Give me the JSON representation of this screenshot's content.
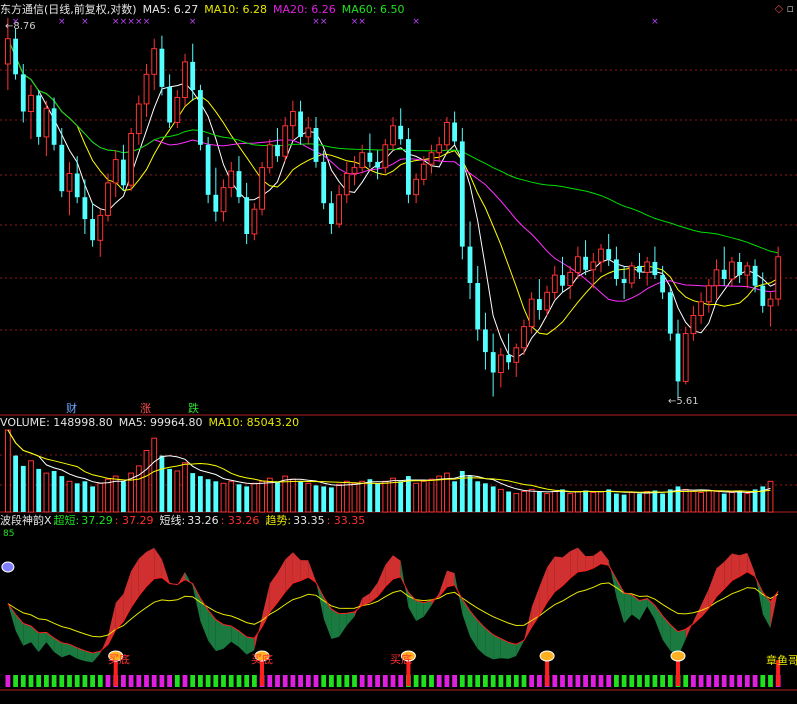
{
  "main_header": {
    "title": "东方通信(日线,前复权,对数)",
    "ma5_label": "MA5: 6.27",
    "ma10_label": "MA10: 6.28",
    "ma20_label": "MA20: 6.26",
    "ma60_label": "MA60: 6.50"
  },
  "corner": {
    "diamond": "◇",
    "square": "▫"
  },
  "price_marks": {
    "high": "8.76",
    "low": "5.61"
  },
  "event_labels": {
    "cai": "财",
    "zhang": "涨",
    "die": "跌"
  },
  "volume_header": {
    "label": "VOLUME: 148998.80",
    "ma5": "MA5: 99964.80",
    "ma10": "MA10: 85043.20"
  },
  "indicator_header": {
    "name": "波段神韵X",
    "chaoduan_label": "超短:",
    "chaoduan_val1": "37.29",
    "chaoduan_val2": ": 37.29",
    "duanxian_label": "短线:",
    "duanxian_val1": "33.26",
    "duanxian_val2": ": 33.26",
    "qushi_label": "趋势:",
    "qushi_val1": "33.35",
    "qushi_val2": ": 33.35",
    "level_mark": "85"
  },
  "signal_labels": {
    "maidi": "买底",
    "zhangyu": "章鱼哥"
  },
  "colors": {
    "bg": "#000000",
    "up": "#ff3232",
    "down": "#54ffff",
    "ma5": "#ffffff",
    "ma10": "#ffff00",
    "ma20": "#ff30ff",
    "ma60": "#00e000",
    "grid": "#8a1a1a"
  },
  "chart_data": [
    {
      "type": "candlestick",
      "title": "东方通信(日线,前复权,对数)",
      "series_names": [
        "MA5",
        "MA10",
        "MA20",
        "MA60"
      ],
      "price_range": [
        5.61,
        8.76
      ],
      "price_high": 8.76,
      "price_low": 5.61,
      "ohlc": [
        [
          8.3,
          8.76,
          8.05,
          8.55
        ],
        [
          8.55,
          8.65,
          8.15,
          8.2
        ],
        [
          8.2,
          8.3,
          7.75,
          7.85
        ],
        [
          7.85,
          8.1,
          7.6,
          8.0
        ],
        [
          8.0,
          8.05,
          7.55,
          7.62
        ],
        [
          7.62,
          7.95,
          7.45,
          7.88
        ],
        [
          7.88,
          7.98,
          7.5,
          7.55
        ],
        [
          7.55,
          7.7,
          7.1,
          7.15
        ],
        [
          7.15,
          7.4,
          6.95,
          7.3
        ],
        [
          7.3,
          7.45,
          7.05,
          7.1
        ],
        [
          7.1,
          7.25,
          6.8,
          6.92
        ],
        [
          6.92,
          7.05,
          6.7,
          6.75
        ],
        [
          6.75,
          7.0,
          6.62,
          6.95
        ],
        [
          6.95,
          7.3,
          6.9,
          7.22
        ],
        [
          7.22,
          7.5,
          7.1,
          7.42
        ],
        [
          7.42,
          7.55,
          7.15,
          7.2
        ],
        [
          7.2,
          7.7,
          7.15,
          7.65
        ],
        [
          7.65,
          8.0,
          7.55,
          7.92
        ],
        [
          7.92,
          8.3,
          7.8,
          8.2
        ],
        [
          8.2,
          8.55,
          8.05,
          8.45
        ],
        [
          8.45,
          8.58,
          8.0,
          8.08
        ],
        [
          8.08,
          8.2,
          7.7,
          7.75
        ],
        [
          7.75,
          8.05,
          7.7,
          7.98
        ],
        [
          7.98,
          8.4,
          7.9,
          8.32
        ],
        [
          8.32,
          8.5,
          7.95,
          8.05
        ],
        [
          8.05,
          8.1,
          7.5,
          7.55
        ],
        [
          7.55,
          7.62,
          7.05,
          7.12
        ],
        [
          7.12,
          7.35,
          6.9,
          6.98
        ],
        [
          6.98,
          7.25,
          6.9,
          7.18
        ],
        [
          7.18,
          7.4,
          7.1,
          7.32
        ],
        [
          7.32,
          7.45,
          7.05,
          7.1
        ],
        [
          7.1,
          7.22,
          6.72,
          6.8
        ],
        [
          6.8,
          7.05,
          6.75,
          7.0
        ],
        [
          7.0,
          7.4,
          6.95,
          7.35
        ],
        [
          7.35,
          7.6,
          7.3,
          7.55
        ],
        [
          7.55,
          7.7,
          7.4,
          7.45
        ],
        [
          7.45,
          7.8,
          7.4,
          7.72
        ],
        [
          7.72,
          7.95,
          7.6,
          7.85
        ],
        [
          7.85,
          7.95,
          7.55,
          7.62
        ],
        [
          7.62,
          7.8,
          7.55,
          7.7
        ],
        [
          7.7,
          7.8,
          7.35,
          7.4
        ],
        [
          7.4,
          7.5,
          7.0,
          7.05
        ],
        [
          7.05,
          7.15,
          6.8,
          6.88
        ],
        [
          6.88,
          7.2,
          6.85,
          7.12
        ],
        [
          7.12,
          7.4,
          7.05,
          7.3
        ],
        [
          7.3,
          7.45,
          7.2,
          7.35
        ],
        [
          7.35,
          7.55,
          7.3,
          7.48
        ],
        [
          7.48,
          7.65,
          7.35,
          7.4
        ],
        [
          7.4,
          7.5,
          7.25,
          7.35
        ],
        [
          7.35,
          7.6,
          7.3,
          7.55
        ],
        [
          7.55,
          7.8,
          7.5,
          7.72
        ],
        [
          7.72,
          7.88,
          7.55,
          7.6
        ],
        [
          7.6,
          7.7,
          7.05,
          7.12
        ],
        [
          7.12,
          7.3,
          7.05,
          7.25
        ],
        [
          7.25,
          7.45,
          7.2,
          7.38
        ],
        [
          7.38,
          7.55,
          7.3,
          7.48
        ],
        [
          7.48,
          7.62,
          7.4,
          7.55
        ],
        [
          7.55,
          7.8,
          7.5,
          7.75
        ],
        [
          7.75,
          7.85,
          7.55,
          7.58
        ],
        [
          7.58,
          7.7,
          6.6,
          6.7
        ],
        [
          6.7,
          6.9,
          6.3,
          6.42
        ],
        [
          6.42,
          6.55,
          6.0,
          6.08
        ],
        [
          6.08,
          6.2,
          5.8,
          5.92
        ],
        [
          5.92,
          6.05,
          5.62,
          5.78
        ],
        [
          5.78,
          5.95,
          5.68,
          5.9
        ],
        [
          5.9,
          6.05,
          5.8,
          5.85
        ],
        [
          5.85,
          5.98,
          5.75,
          5.95
        ],
        [
          5.95,
          6.15,
          5.9,
          6.1
        ],
        [
          6.1,
          6.35,
          6.05,
          6.3
        ],
        [
          6.3,
          6.45,
          6.15,
          6.22
        ],
        [
          6.22,
          6.4,
          6.18,
          6.35
        ],
        [
          6.35,
          6.55,
          6.3,
          6.48
        ],
        [
          6.48,
          6.62,
          6.35,
          6.4
        ],
        [
          6.4,
          6.55,
          6.3,
          6.5
        ],
        [
          6.5,
          6.7,
          6.45,
          6.62
        ],
        [
          6.62,
          6.75,
          6.48,
          6.52
        ],
        [
          6.52,
          6.65,
          6.38,
          6.58
        ],
        [
          6.58,
          6.72,
          6.5,
          6.68
        ],
        [
          6.68,
          6.8,
          6.55,
          6.6
        ],
        [
          6.6,
          6.7,
          6.4,
          6.45
        ],
        [
          6.45,
          6.55,
          6.3,
          6.42
        ],
        [
          6.42,
          6.58,
          6.38,
          6.55
        ],
        [
          6.55,
          6.65,
          6.45,
          6.5
        ],
        [
          6.5,
          6.62,
          6.4,
          6.58
        ],
        [
          6.58,
          6.7,
          6.45,
          6.48
        ],
        [
          6.48,
          6.55,
          6.3,
          6.35
        ],
        [
          6.35,
          6.4,
          6.0,
          6.05
        ],
        [
          6.05,
          6.15,
          5.61,
          5.72
        ],
        [
          5.72,
          6.1,
          5.7,
          6.05
        ],
        [
          6.05,
          6.25,
          6.0,
          6.18
        ],
        [
          6.18,
          6.35,
          6.12,
          6.28
        ],
        [
          6.28,
          6.45,
          6.2,
          6.4
        ],
        [
          6.4,
          6.6,
          6.3,
          6.52
        ],
        [
          6.52,
          6.7,
          6.4,
          6.45
        ],
        [
          6.45,
          6.62,
          6.4,
          6.58
        ],
        [
          6.58,
          6.65,
          6.42,
          6.48
        ],
        [
          6.48,
          6.58,
          6.38,
          6.55
        ],
        [
          6.55,
          6.6,
          6.35,
          6.4
        ],
        [
          6.4,
          6.5,
          6.2,
          6.25
        ],
        [
          6.25,
          6.35,
          6.1,
          6.3
        ],
        [
          6.3,
          6.7,
          6.25,
          6.62
        ]
      ]
    },
    {
      "type": "bar",
      "title": "VOLUME",
      "series_names": [
        "VOLUME",
        "MA5",
        "MA10"
      ],
      "last_volume": 148998.8,
      "last_ma5": 99964.8,
      "last_ma10": 85043.2,
      "volumes": [
        0.8,
        0.55,
        0.45,
        0.5,
        0.42,
        0.38,
        0.4,
        0.35,
        0.3,
        0.28,
        0.3,
        0.25,
        0.28,
        0.32,
        0.35,
        0.3,
        0.38,
        0.45,
        0.6,
        0.72,
        0.55,
        0.42,
        0.4,
        0.48,
        0.38,
        0.35,
        0.32,
        0.3,
        0.28,
        0.3,
        0.27,
        0.25,
        0.28,
        0.3,
        0.33,
        0.3,
        0.35,
        0.32,
        0.3,
        0.28,
        0.26,
        0.25,
        0.24,
        0.27,
        0.3,
        0.28,
        0.3,
        0.32,
        0.28,
        0.3,
        0.33,
        0.3,
        0.35,
        0.28,
        0.3,
        0.32,
        0.35,
        0.38,
        0.3,
        0.4,
        0.35,
        0.3,
        0.28,
        0.25,
        0.22,
        0.2,
        0.18,
        0.2,
        0.22,
        0.2,
        0.18,
        0.2,
        0.22,
        0.18,
        0.2,
        0.21,
        0.19,
        0.2,
        0.22,
        0.18,
        0.17,
        0.19,
        0.18,
        0.2,
        0.21,
        0.18,
        0.22,
        0.25,
        0.22,
        0.2,
        0.19,
        0.21,
        0.2,
        0.18,
        0.19,
        0.2,
        0.18,
        0.22,
        0.25,
        0.3
      ]
    },
    {
      "type": "line",
      "title": "波段神韵X",
      "series_names": [
        "超短",
        "短线",
        "趋势"
      ],
      "last_values": {
        "超短": 37.29,
        "短线": 33.26,
        "趋势": 33.35
      },
      "level_mark": 85
    }
  ]
}
